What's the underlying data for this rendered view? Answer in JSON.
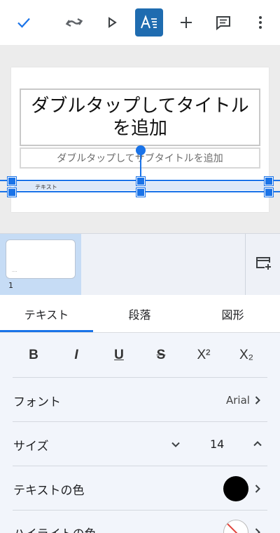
{
  "toolbar": {
    "confirm_icon": "check-icon",
    "redo_icon": "redo-icon",
    "play_icon": "play-icon",
    "format_icon": "text-format-icon",
    "insert_icon": "plus-icon",
    "comment_icon": "comment-icon",
    "more_icon": "more-vert-icon",
    "accent": "#1a73e8",
    "active_bg": "#1f6cb0"
  },
  "slide": {
    "title_placeholder": "ダブルタップしてタイトルを追加",
    "subtitle_placeholder": "ダブルタップしてサブタイトルを追加",
    "selected_text": "テキスト"
  },
  "filmstrip": {
    "thumb_text": "....",
    "slide_number": "1",
    "new_slide_icon": "add-slide-icon"
  },
  "tabs": [
    {
      "label": "テキスト",
      "active": true
    },
    {
      "label": "段落",
      "active": false
    },
    {
      "label": "図形",
      "active": false
    }
  ],
  "format_buttons": [
    {
      "label": "B",
      "icon": "bold-icon"
    },
    {
      "label": "I",
      "icon": "italic-icon"
    },
    {
      "label": "U",
      "icon": "underline-icon"
    },
    {
      "label": "S",
      "icon": "strikethrough-icon"
    },
    {
      "label": "X²",
      "icon": "superscript-icon"
    },
    {
      "label": "X₂",
      "icon": "subscript-icon"
    }
  ],
  "properties": {
    "font_label": "フォント",
    "font_value": "Arial",
    "size_label": "サイズ",
    "size_value": "14",
    "text_color_label": "テキストの色",
    "text_color_value": "#000000",
    "highlight_label": "ハイライトの色"
  }
}
